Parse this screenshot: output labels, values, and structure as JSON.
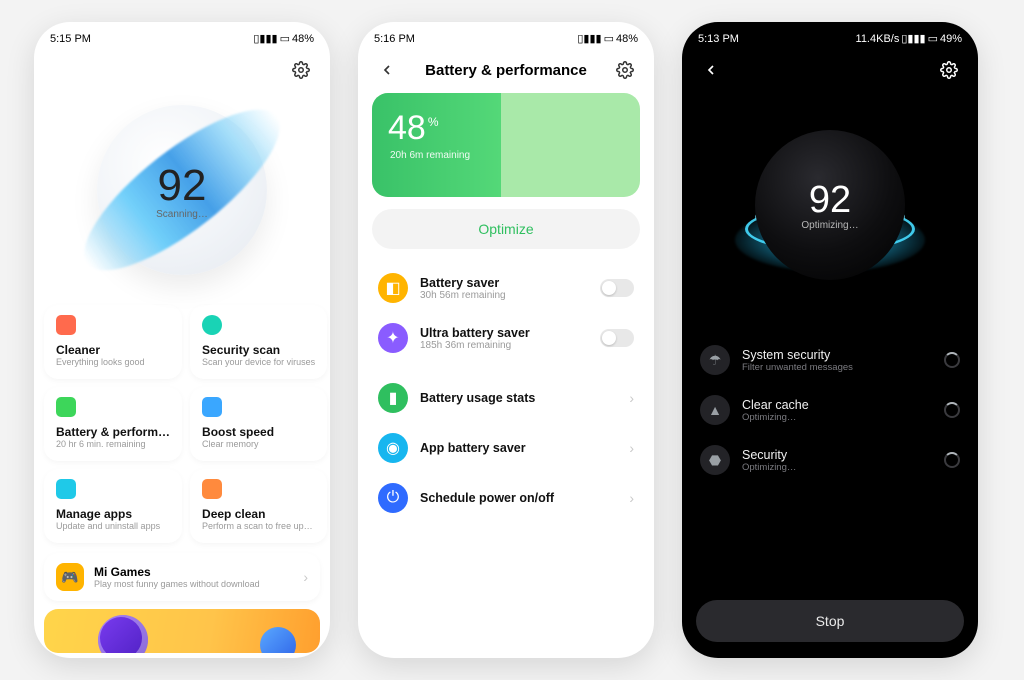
{
  "screen1": {
    "status": {
      "time": "5:15 PM",
      "battery": "48%"
    },
    "score": "92",
    "status_label": "Scanning…",
    "tiles": [
      {
        "title": "Cleaner",
        "sub": "Everything looks good",
        "color": "#ff6a4d"
      },
      {
        "title": "Security scan",
        "sub": "Scan your device for viruses",
        "color": "#19d3b5"
      },
      {
        "title": "Battery & perform…",
        "sub": "20 hr 6 min. remaining",
        "color": "#3dd65a"
      },
      {
        "title": "Boost speed",
        "sub": "Clear memory",
        "color": "#3aa7ff"
      },
      {
        "title": "Manage apps",
        "sub": "Update and uninstall apps",
        "color": "#1fc9e8"
      },
      {
        "title": "Deep clean",
        "sub": "Perform a scan to free up…",
        "color": "#ff8a3d"
      }
    ],
    "promo": {
      "title": "Mi Games",
      "sub": "Play most funny games without download"
    }
  },
  "screen2": {
    "status": {
      "time": "5:16 PM",
      "battery": "48%"
    },
    "title": "Battery & performance",
    "battery_pct": "48",
    "battery_pct_suffix": "%",
    "remaining": "20h 6m remaining",
    "fill_width": "48%",
    "optimize_label": "Optimize",
    "savers": [
      {
        "title": "Battery saver",
        "sub": "30h 56m remaining",
        "color": "#ffb400"
      },
      {
        "title": "Ultra battery saver",
        "sub": "185h 36m remaining",
        "color": "#8a5cff"
      }
    ],
    "links": [
      {
        "title": "Battery usage stats",
        "color": "#2fbf5f"
      },
      {
        "title": "App battery saver",
        "color": "#17b6ef"
      },
      {
        "title": "Schedule power on/off",
        "color": "#2f6bff"
      }
    ]
  },
  "screen3": {
    "status": {
      "time": "5:13 PM",
      "net": "11.4KB/s",
      "battery": "49%"
    },
    "score": "92",
    "status_label": "Optimizing…",
    "items": [
      {
        "title": "System security",
        "sub": "Filter unwanted messages",
        "icon": "umbrella"
      },
      {
        "title": "Clear cache",
        "sub": "Optimizing…",
        "icon": "rocket"
      },
      {
        "title": "Security",
        "sub": "Optimizing…",
        "icon": "shield"
      }
    ],
    "stop_label": "Stop"
  }
}
